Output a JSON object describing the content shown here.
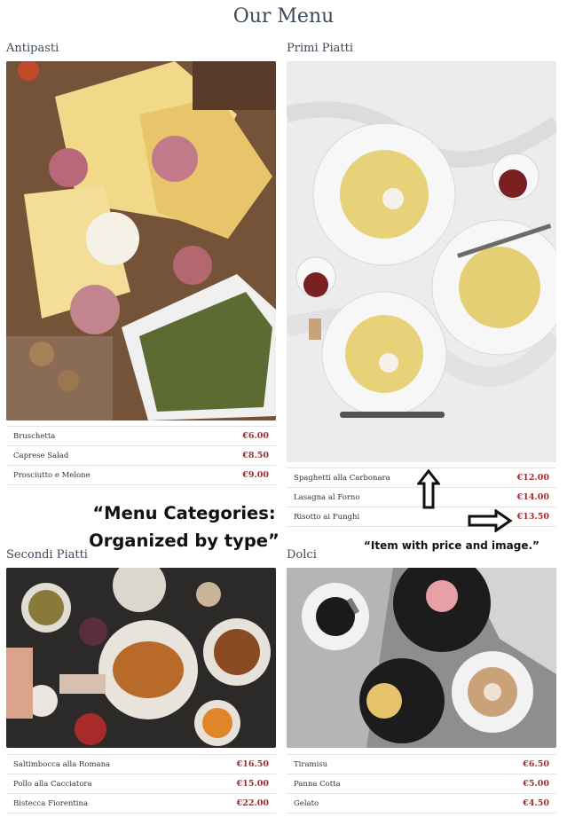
{
  "page": {
    "title": "Our Menu"
  },
  "categories": [
    {
      "name": "Antipasti",
      "image_icon": "antipasti-photo",
      "items": [
        {
          "name": "Bruschetta",
          "price": "€6.00"
        },
        {
          "name": "Caprese Salad",
          "price": "€8.50"
        },
        {
          "name": "Prosciutto e Melone",
          "price": "€9.00"
        }
      ]
    },
    {
      "name": "Primi Piatti",
      "image_icon": "primi-piatti-photo",
      "items": [
        {
          "name": "Spaghetti alla Carbonara",
          "price": "€12.00"
        },
        {
          "name": "Lasagna al Forno",
          "price": "€14.00"
        },
        {
          "name": "Risotto ai Funghi",
          "price": "€13.50"
        }
      ]
    },
    {
      "name": "Secondi Piatti",
      "image_icon": "secondi-piatti-photo",
      "items": [
        {
          "name": "Saltimbocca alla Romana",
          "price": "€16.50"
        },
        {
          "name": "Pollo alla Cacciatora",
          "price": "€15.00"
        },
        {
          "name": "Bistecca Fiorentina",
          "price": "€22.00"
        }
      ]
    },
    {
      "name": "Dolci",
      "image_icon": "dolci-photo",
      "items": [
        {
          "name": "Tiramisu",
          "price": "€6.50"
        },
        {
          "name": "Panna Cotta",
          "price": "€5.00"
        },
        {
          "name": "Gelato",
          "price": "€4.50"
        }
      ]
    }
  ],
  "annotations": {
    "categories_line1": "“Menu Categories:",
    "categories_line2": "Organized by type”",
    "item_note": "“Item with price and image.”"
  },
  "colors": {
    "price": "#a32d2d",
    "heading": "#3c4a5c"
  }
}
